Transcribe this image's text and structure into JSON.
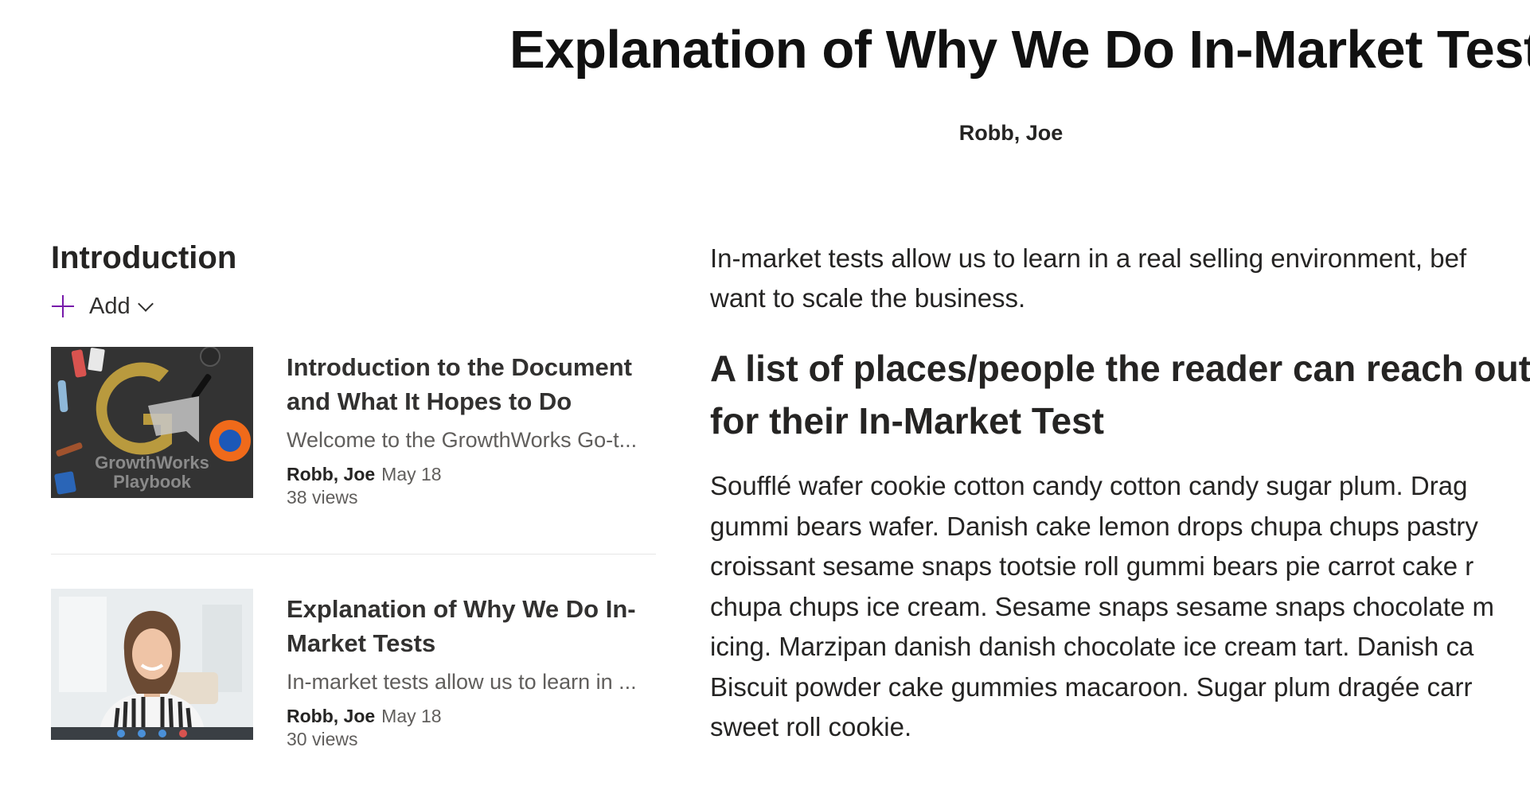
{
  "article": {
    "title": "Explanation of Why We Do In-Market Tests",
    "author": "Robb, Joe"
  },
  "sidebar": {
    "section_title": "Introduction",
    "add_label": "Add",
    "cards": [
      {
        "title": "Introduction to the Document and What It Hopes to Do",
        "description": "Welcome to the GrowthWorks Go-t...",
        "author": "Robb, Joe",
        "date": "May 18",
        "views": "38 views",
        "thumbnail_text": "GrowthWorks\nPlaybook"
      },
      {
        "title": "Explanation of Why We Do In-Market Tests",
        "description": "In-market tests allow us to learn in ...",
        "author": "Robb, Joe",
        "date": "May 18",
        "views": "30 views"
      }
    ]
  },
  "content": {
    "intro_lines": [
      "In-market tests allow us to learn in a real selling environment, bef",
      "want to scale the business."
    ],
    "heading_lines": [
      "A list of places/people the reader can reach out",
      "for their In-Market Test"
    ],
    "body_lines": [
      "Soufflé wafer cookie cotton candy cotton candy sugar plum. Drag",
      "gummi bears wafer. Danish cake lemon drops chupa chups pastry",
      "croissant sesame snaps tootsie roll gummi bears pie carrot cake r",
      "chupa chups ice cream. Sesame snaps sesame snaps chocolate m",
      "icing. Marzipan danish danish chocolate ice cream tart. Danish ca",
      "Biscuit powder cake gummies macaroon. Sugar plum dragée carr",
      "sweet roll cookie."
    ]
  },
  "colors": {
    "accent": "#7719aa",
    "text_primary": "#252423",
    "text_secondary": "#605e5c"
  }
}
